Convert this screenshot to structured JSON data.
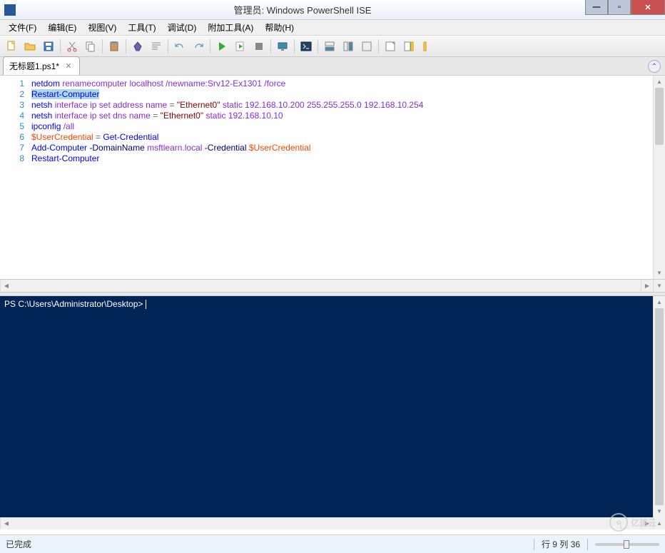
{
  "window": {
    "title": "管理员: Windows PowerShell ISE"
  },
  "menu": {
    "file": "文件(F)",
    "edit": "编辑(E)",
    "view": "视图(V)",
    "tools": "工具(T)",
    "debug": "调试(D)",
    "addons": "附加工具(A)",
    "help": "帮助(H)"
  },
  "tab": {
    "name": "无标题1.ps1*"
  },
  "code": {
    "lines": [
      {
        "n": "1",
        "tokens": [
          {
            "t": "netdom",
            "c": "tk-cmd"
          },
          {
            "t": " "
          },
          {
            "t": "renamecomputer",
            "c": "tk-txt"
          },
          {
            "t": " "
          },
          {
            "t": "localhost",
            "c": "tk-txt"
          },
          {
            "t": " "
          },
          {
            "t": "/newname:Srv12-Ex1301",
            "c": "tk-txt"
          },
          {
            "t": " "
          },
          {
            "t": "/force",
            "c": "tk-txt"
          }
        ]
      },
      {
        "n": "2",
        "tokens": [
          {
            "t": "Restart-Computer",
            "c": "tk-cmd sel"
          }
        ]
      },
      {
        "n": "3",
        "tokens": [
          {
            "t": "netsh",
            "c": "tk-cmd"
          },
          {
            "t": " "
          },
          {
            "t": "interface",
            "c": "tk-txt"
          },
          {
            "t": " "
          },
          {
            "t": "ip",
            "c": "tk-txt"
          },
          {
            "t": " "
          },
          {
            "t": "set",
            "c": "tk-txt"
          },
          {
            "t": " "
          },
          {
            "t": "address",
            "c": "tk-txt"
          },
          {
            "t": " "
          },
          {
            "t": "name",
            "c": "tk-txt"
          },
          {
            "t": " "
          },
          {
            "t": "=",
            "c": "tk-op"
          },
          {
            "t": " "
          },
          {
            "t": "\"Ethernet0\"",
            "c": "tk-str"
          },
          {
            "t": " "
          },
          {
            "t": "static",
            "c": "tk-txt"
          },
          {
            "t": " "
          },
          {
            "t": "192.168.10.200",
            "c": "tk-txt"
          },
          {
            "t": " "
          },
          {
            "t": "255.255.255.0",
            "c": "tk-txt"
          },
          {
            "t": " "
          },
          {
            "t": "192.168.10.254",
            "c": "tk-txt"
          }
        ]
      },
      {
        "n": "4",
        "tokens": [
          {
            "t": "netsh",
            "c": "tk-cmd"
          },
          {
            "t": " "
          },
          {
            "t": "interface",
            "c": "tk-txt"
          },
          {
            "t": " "
          },
          {
            "t": "ip",
            "c": "tk-txt"
          },
          {
            "t": " "
          },
          {
            "t": "set",
            "c": "tk-txt"
          },
          {
            "t": " "
          },
          {
            "t": "dns",
            "c": "tk-txt"
          },
          {
            "t": " "
          },
          {
            "t": "name",
            "c": "tk-txt"
          },
          {
            "t": " "
          },
          {
            "t": "=",
            "c": "tk-op"
          },
          {
            "t": " "
          },
          {
            "t": "\"Ethernet0\"",
            "c": "tk-str"
          },
          {
            "t": " "
          },
          {
            "t": "static",
            "c": "tk-txt"
          },
          {
            "t": " "
          },
          {
            "t": "192.168.10.10",
            "c": "tk-txt"
          }
        ]
      },
      {
        "n": "5",
        "tokens": [
          {
            "t": "ipconfig",
            "c": "tk-cmd"
          },
          {
            "t": " "
          },
          {
            "t": "/all",
            "c": "tk-txt"
          }
        ]
      },
      {
        "n": "6",
        "tokens": [
          {
            "t": "$UserCredential",
            "c": "tk-var"
          },
          {
            "t": " "
          },
          {
            "t": "=",
            "c": "tk-op"
          },
          {
            "t": " "
          },
          {
            "t": "Get-Credential",
            "c": "tk-cmd"
          }
        ]
      },
      {
        "n": "7",
        "tokens": [
          {
            "t": "Add-Computer",
            "c": "tk-cmd"
          },
          {
            "t": " "
          },
          {
            "t": "-DomainName",
            "c": "tk-param"
          },
          {
            "t": " "
          },
          {
            "t": "msftlearn.local",
            "c": "tk-txt"
          },
          {
            "t": " "
          },
          {
            "t": "-Credential",
            "c": "tk-param"
          },
          {
            "t": " "
          },
          {
            "t": "$UserCredential",
            "c": "tk-var"
          }
        ]
      },
      {
        "n": "8",
        "tokens": [
          {
            "t": "Restart-Computer",
            "c": "tk-cmd"
          }
        ]
      }
    ]
  },
  "console": {
    "prompt": "PS C:\\Users\\Administrator\\Desktop> "
  },
  "status": {
    "left": "已完成",
    "position": "行 9 列 36"
  },
  "watermark": {
    "text": "亿速云"
  }
}
